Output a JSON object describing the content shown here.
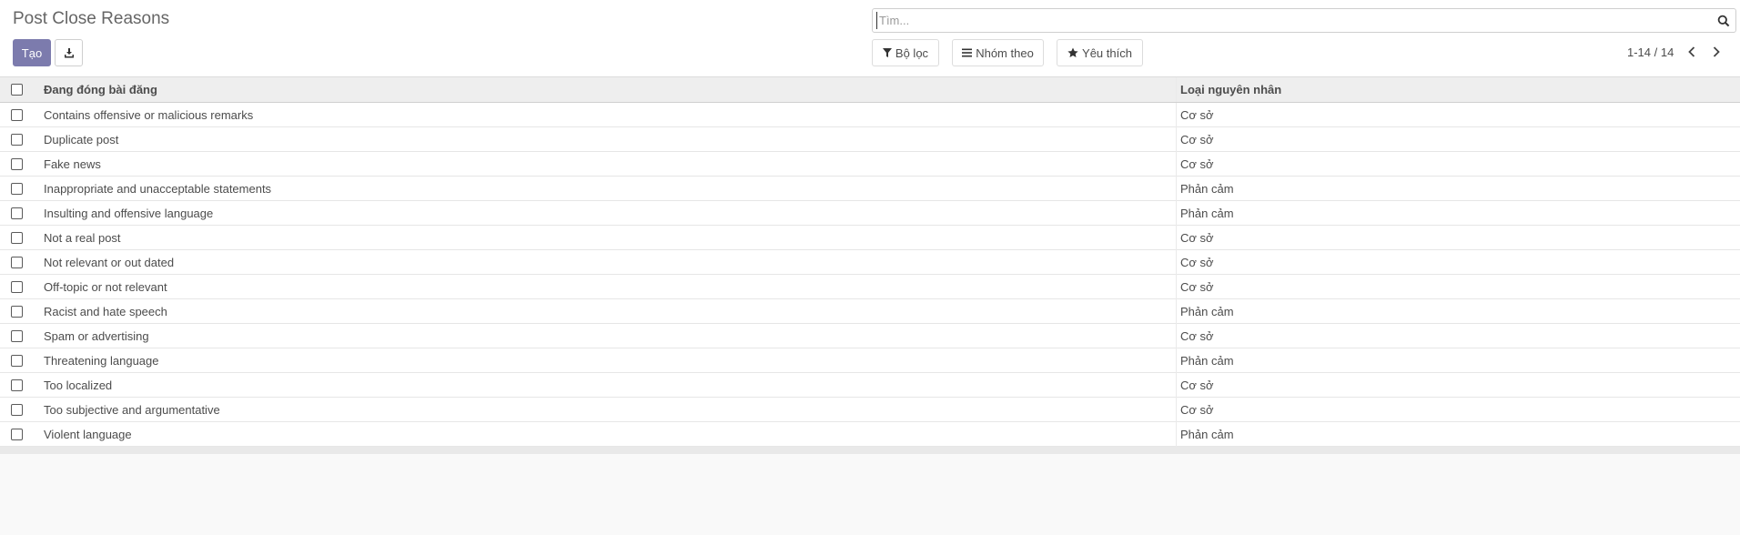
{
  "header": {
    "title": "Post Close Reasons",
    "create_label": "Tạo",
    "search_placeholder": "Tìm...",
    "filters": {
      "filter_label": "Bộ lọc",
      "group_label": "Nhóm theo",
      "favorites_label": "Yêu thích"
    },
    "pager": "1-14 / 14"
  },
  "table": {
    "columns": {
      "name": "Đang đóng bài đăng",
      "reason_type": "Loại nguyên nhân"
    },
    "rows": [
      {
        "name": "Contains offensive or malicious remarks",
        "type": "Cơ sở"
      },
      {
        "name": "Duplicate post",
        "type": "Cơ sở"
      },
      {
        "name": "Fake news",
        "type": "Cơ sở"
      },
      {
        "name": "Inappropriate and unacceptable statements",
        "type": "Phản cảm"
      },
      {
        "name": "Insulting and offensive language",
        "type": "Phản cảm"
      },
      {
        "name": "Not a real post",
        "type": "Cơ sở"
      },
      {
        "name": "Not relevant or out dated",
        "type": "Cơ sở"
      },
      {
        "name": "Off-topic or not relevant",
        "type": "Cơ sở"
      },
      {
        "name": "Racist and hate speech",
        "type": "Phản cảm"
      },
      {
        "name": "Spam or advertising",
        "type": "Cơ sở"
      },
      {
        "name": "Threatening language",
        "type": "Phản cảm"
      },
      {
        "name": "Too localized",
        "type": "Cơ sở"
      },
      {
        "name": "Too subjective and argumentative",
        "type": "Cơ sở"
      },
      {
        "name": "Violent language",
        "type": "Phản cảm"
      }
    ]
  },
  "colors": {
    "primary": "#7c7bad",
    "header_bg": "#eeeeee",
    "body_bg": "#f9f9f9"
  },
  "icons": {
    "download": "download-icon",
    "search": "search-icon",
    "filter": "filter-icon",
    "group": "bars-icon",
    "favorite": "star-icon",
    "prev": "chevron-left-icon",
    "next": "chevron-right-icon"
  }
}
